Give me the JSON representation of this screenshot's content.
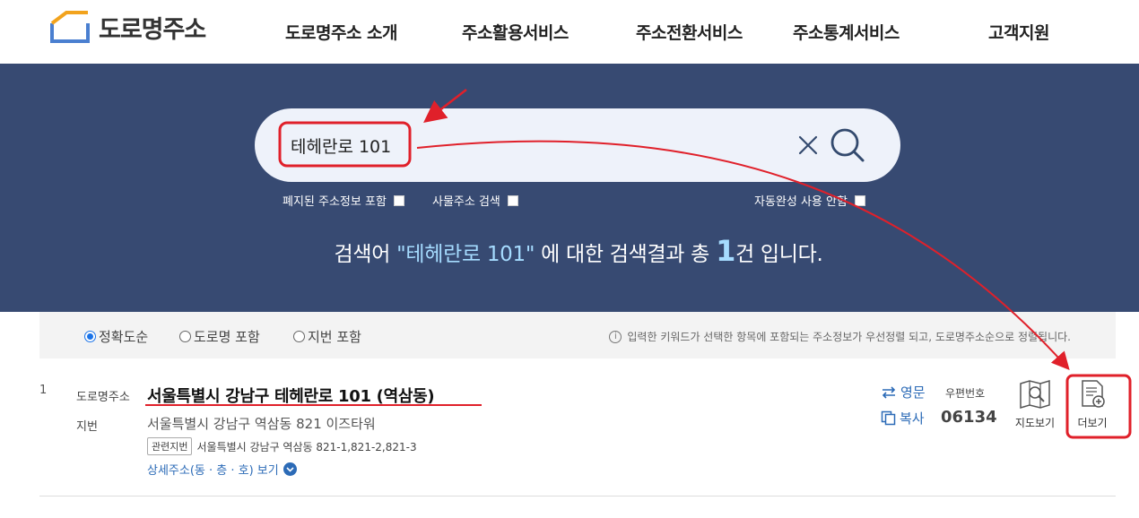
{
  "header": {
    "logo_text": "도로명주소",
    "nav": [
      "도로명주소 소개",
      "주소활용서비스",
      "주소전환서비스",
      "주소통계서비스",
      "고객지원"
    ]
  },
  "search": {
    "query": "테헤란로 101",
    "options": {
      "include_abolished": "폐지된 주소정보 포함",
      "building_search": "사물주소 검색",
      "autocomplete_off": "자동완성 사용 안함"
    },
    "summary": {
      "prefix": "검색어",
      "quoted_term": "\"테헤란로 101\"",
      "middle": "에 대한 검색결과 총",
      "count": "1",
      "suffix": "건 입니다."
    }
  },
  "sort": {
    "options": [
      "정확도순",
      "도로명 포함",
      "지번 포함"
    ],
    "selected_index": 0,
    "note": "입력한 키워드가 선택한 항목에 포함되는 주소정보가 우선정렬 되고, 도로명주소순으로 정렬됩니다."
  },
  "result": {
    "index": "1",
    "road_label": "도로명주소",
    "road_address": "서울특별시 강남구 테헤란로 101 (역삼동)",
    "jibun_label": "지번",
    "jibun_address": "서울특별시 강남구 역삼동 821 이즈타워",
    "related_tag": "관련지번",
    "related_jibun": "서울특별시 강남구 역삼동 821-1,821-2,821-3",
    "detail_link": "상세주소(동 · 층 · 호) 보기",
    "english_label": "영문",
    "copy_label": "복사",
    "zip_label": "우편번호",
    "zip_code": "06134",
    "map_label": "지도보기",
    "more_label": "더보기"
  },
  "colors": {
    "hero_bg": "#374a72",
    "accent_blue": "#2c6bb7",
    "annotation_red": "#e0202a"
  }
}
